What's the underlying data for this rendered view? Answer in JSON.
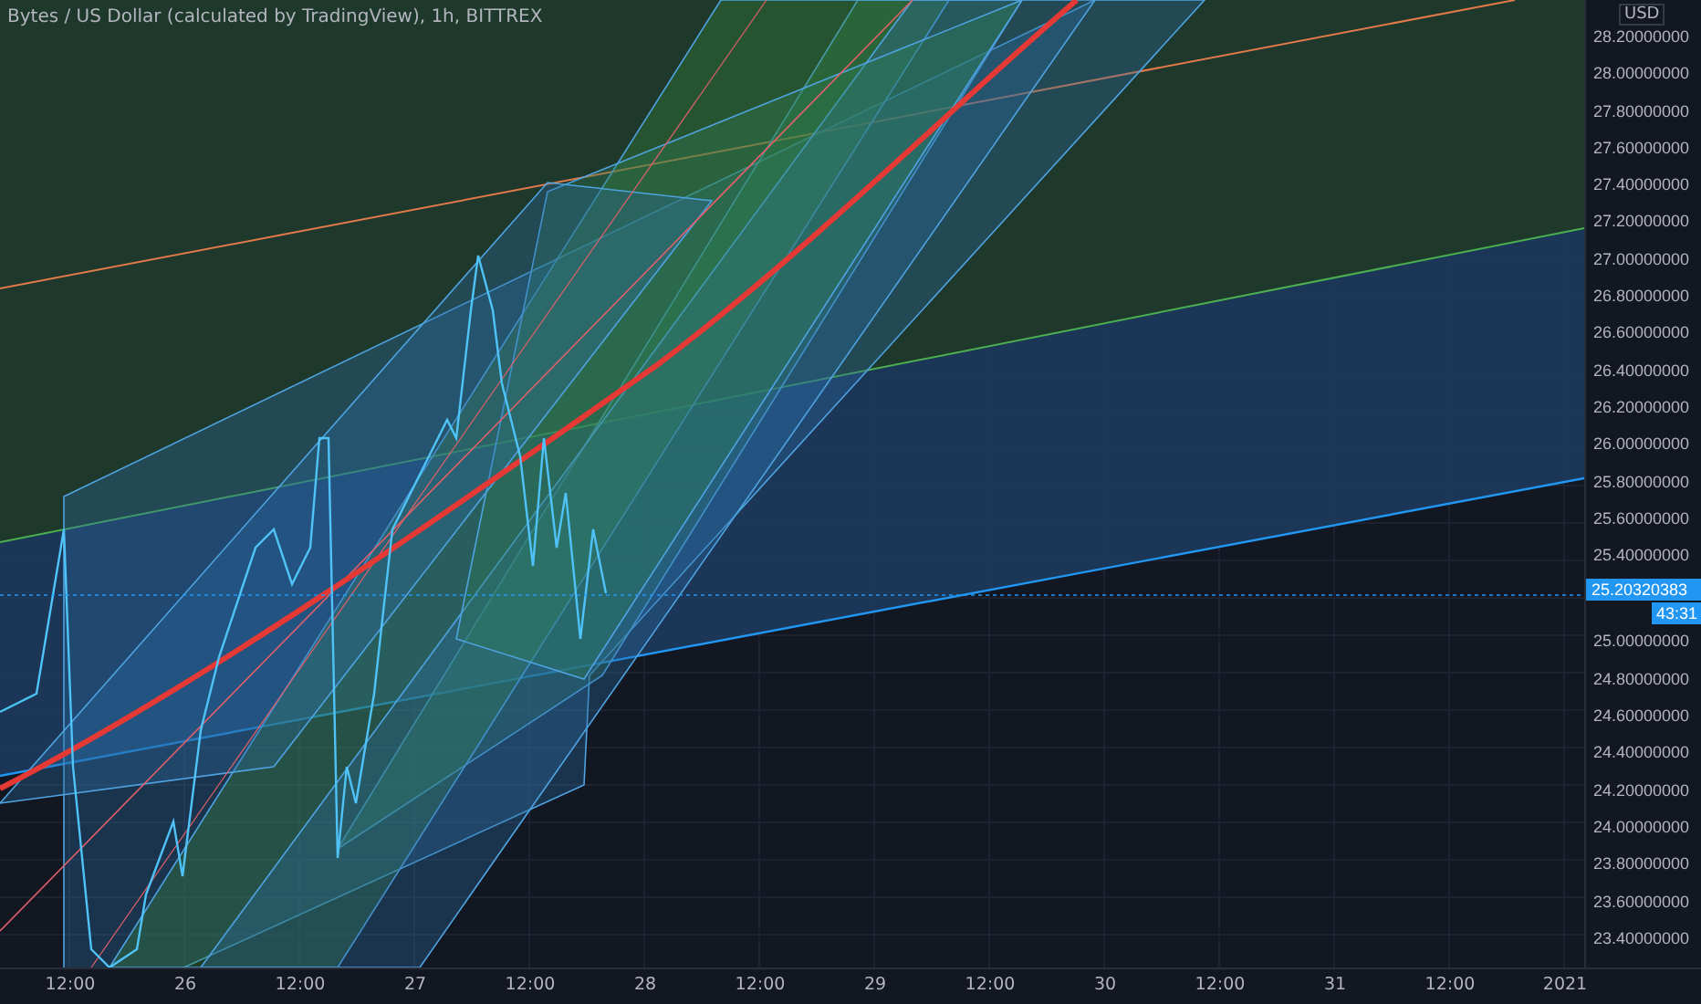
{
  "title": "Bytes / US Dollar (calculated by TradingView), 1h, BITTREX",
  "currency": "USD",
  "price_axis_upper": [
    "28.20000000",
    "28.00000000",
    "27.80000000",
    "27.60000000",
    "27.40000000",
    "27.20000000",
    "27.00000000",
    "26.80000000",
    "26.60000000",
    "26.40000000",
    "26.20000000",
    "26.00000000",
    "25.80000000",
    "25.60000000",
    "25.40000000"
  ],
  "current_price": "25.20320383",
  "countdown": "43:31",
  "price_axis_lower": [
    "25.00000000",
    "24.80000000",
    "24.60000000",
    "24.40000000",
    "24.20000000",
    "24.00000000",
    "23.80000000",
    "23.60000000",
    "23.40000000"
  ],
  "time_axis": [
    "12:00",
    "26",
    "12:00",
    "27",
    "12:00",
    "28",
    "12:00",
    "29",
    "12:00",
    "30",
    "12:00",
    "31",
    "12:00",
    "2021"
  ]
}
